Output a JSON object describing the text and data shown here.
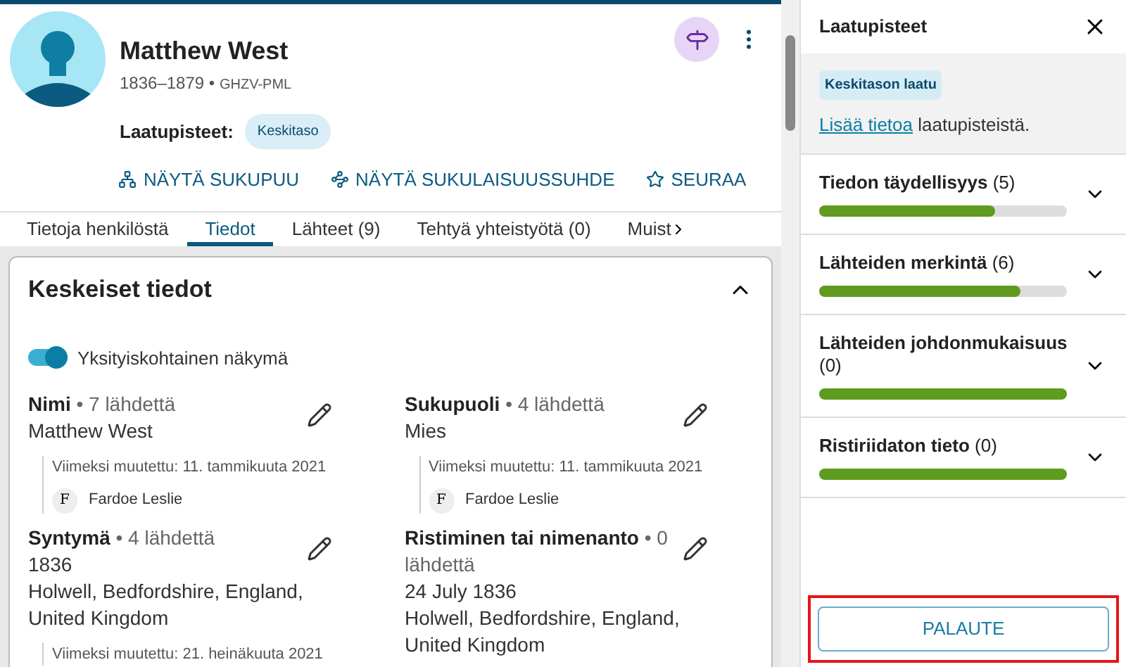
{
  "person": {
    "name": "Matthew West",
    "years": "1836–1879",
    "separator": "•",
    "id": "GHZV-PML"
  },
  "quality": {
    "label": "Laatupisteet:",
    "badge": "Keskitaso"
  },
  "actions": [
    {
      "kind": "tree",
      "label": "NÄYTÄ SUKUPUU"
    },
    {
      "kind": "relation",
      "label": "NÄYTÄ SUKULAISUUSSUHDE"
    },
    {
      "kind": "follow",
      "label": "SEURAA"
    }
  ],
  "tabs": [
    {
      "label": "Tietoja henkilöstä",
      "selected": false
    },
    {
      "label": "Tiedot",
      "selected": true
    },
    {
      "label": "Lähteet (9)",
      "selected": false
    },
    {
      "label": "Tehtyä yhteistyötä (0)",
      "selected": false
    },
    {
      "label": "Muist",
      "selected": false
    }
  ],
  "card": {
    "title": "Keskeiset tiedot",
    "expanded": true,
    "toggle": {
      "label": "Yksityiskohtainen näkymä",
      "on": true
    },
    "facts": [
      {
        "label": "Nimi",
        "sources": "• 7 lähdettä",
        "values": [
          "Matthew West"
        ],
        "edited": "Viimeksi muutettu: 11. tammikuuta 2021",
        "initial": "F",
        "contributor": "Fardoe Leslie"
      },
      {
        "label": "Sukupuoli",
        "sources": "• 4 lähdettä",
        "values": [
          "Mies"
        ],
        "edited": "Viimeksi muutettu: 11. tammikuuta 2021",
        "initial": "F",
        "contributor": "Fardoe Leslie"
      },
      {
        "label": "Syntymä",
        "sources": "• 4 lähdettä",
        "values": [
          "1836",
          "Holwell, Bedfordshire, England, United Kingdom"
        ],
        "edited": "Viimeksi muutettu: 21. heinäkuuta 2021"
      },
      {
        "label": "Ristiminen tai nimenanto",
        "sources": "• 0 lähdettä",
        "values": [
          "24 July 1836",
          "Holwell, Bedfordshire, England, United Kingdom"
        ]
      }
    ]
  },
  "panel": {
    "title": "Laatupisteet",
    "badge": "Keskitason laatu",
    "link": "Lisää tietoa",
    "link_rest": " laatupisteistä.",
    "scores": [
      {
        "label": "Tiedon täydellisyys",
        "count": "(5)",
        "level": 0.71,
        "expanded": false
      },
      {
        "label": "Lähteiden merkintä",
        "count": "(6)",
        "level": 0.81,
        "expanded": false
      },
      {
        "label": "Lähteiden johdonmukaisuus",
        "count": "(0)",
        "level": 1,
        "expanded": false
      },
      {
        "label": "Ristiriidaton tieto",
        "count": "(0)",
        "level": 1,
        "expanded": false
      }
    ],
    "feedback": "PALAUTE"
  }
}
